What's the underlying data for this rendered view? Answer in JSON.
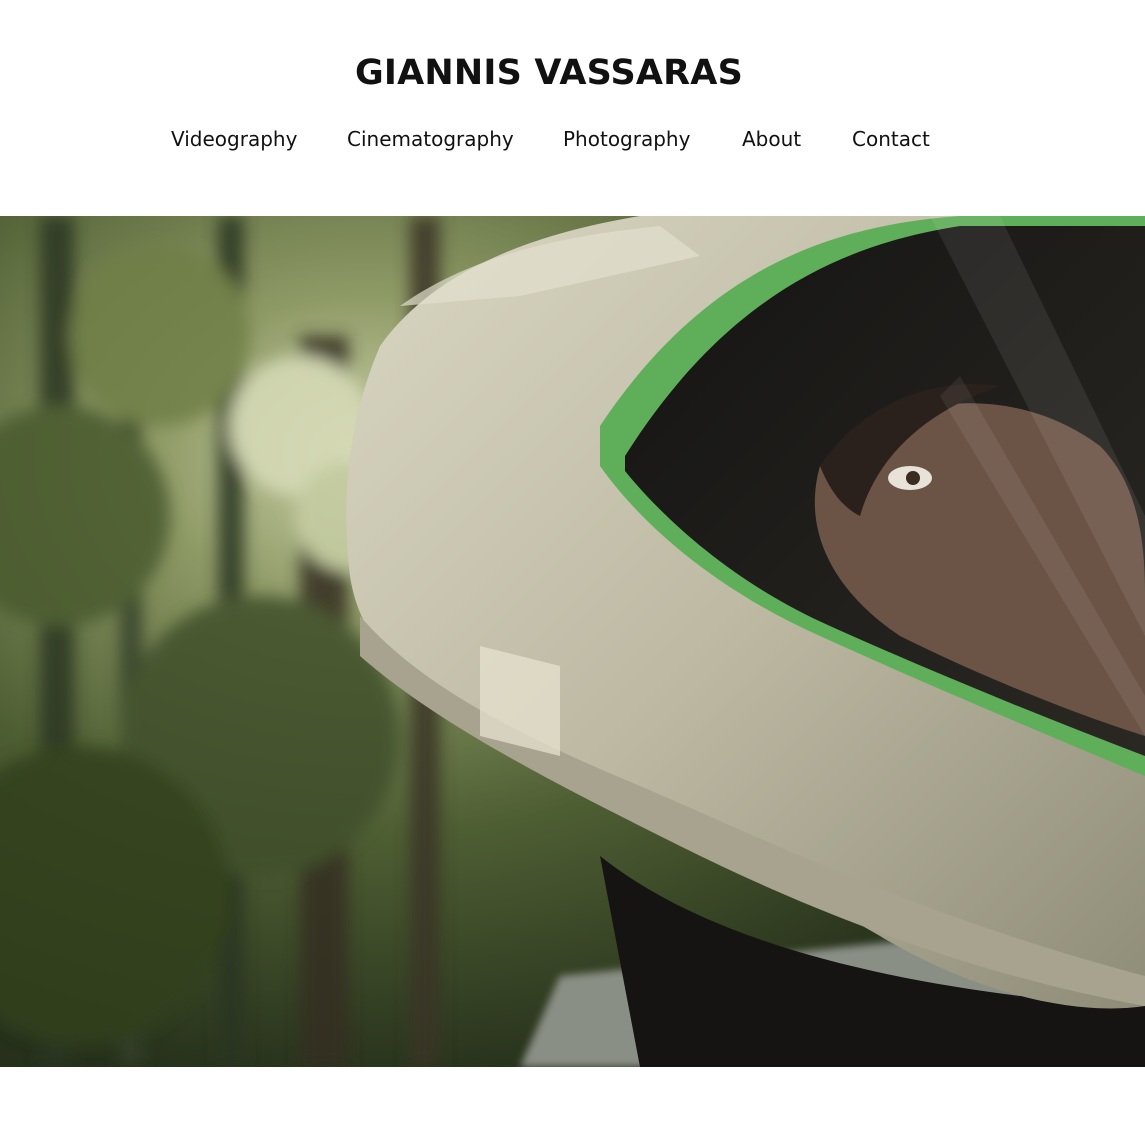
{
  "header": {
    "site_title": "GIANNIS VASSARAS"
  },
  "nav": {
    "items": [
      {
        "label": "Videography"
      },
      {
        "label": "Cinematography"
      },
      {
        "label": "Photography"
      },
      {
        "label": "About"
      },
      {
        "label": "Contact"
      }
    ]
  },
  "hero": {
    "media": "video-still",
    "palette": {
      "forest_dark": "#2e3a22",
      "forest_mid": "#5d6d40",
      "forest_light": "#b9c29a",
      "helmet": "#c9c6b2",
      "visor_trim": "#5fae5a",
      "visor_dark": "#1c1c1a",
      "skin": "#6b5446"
    }
  }
}
